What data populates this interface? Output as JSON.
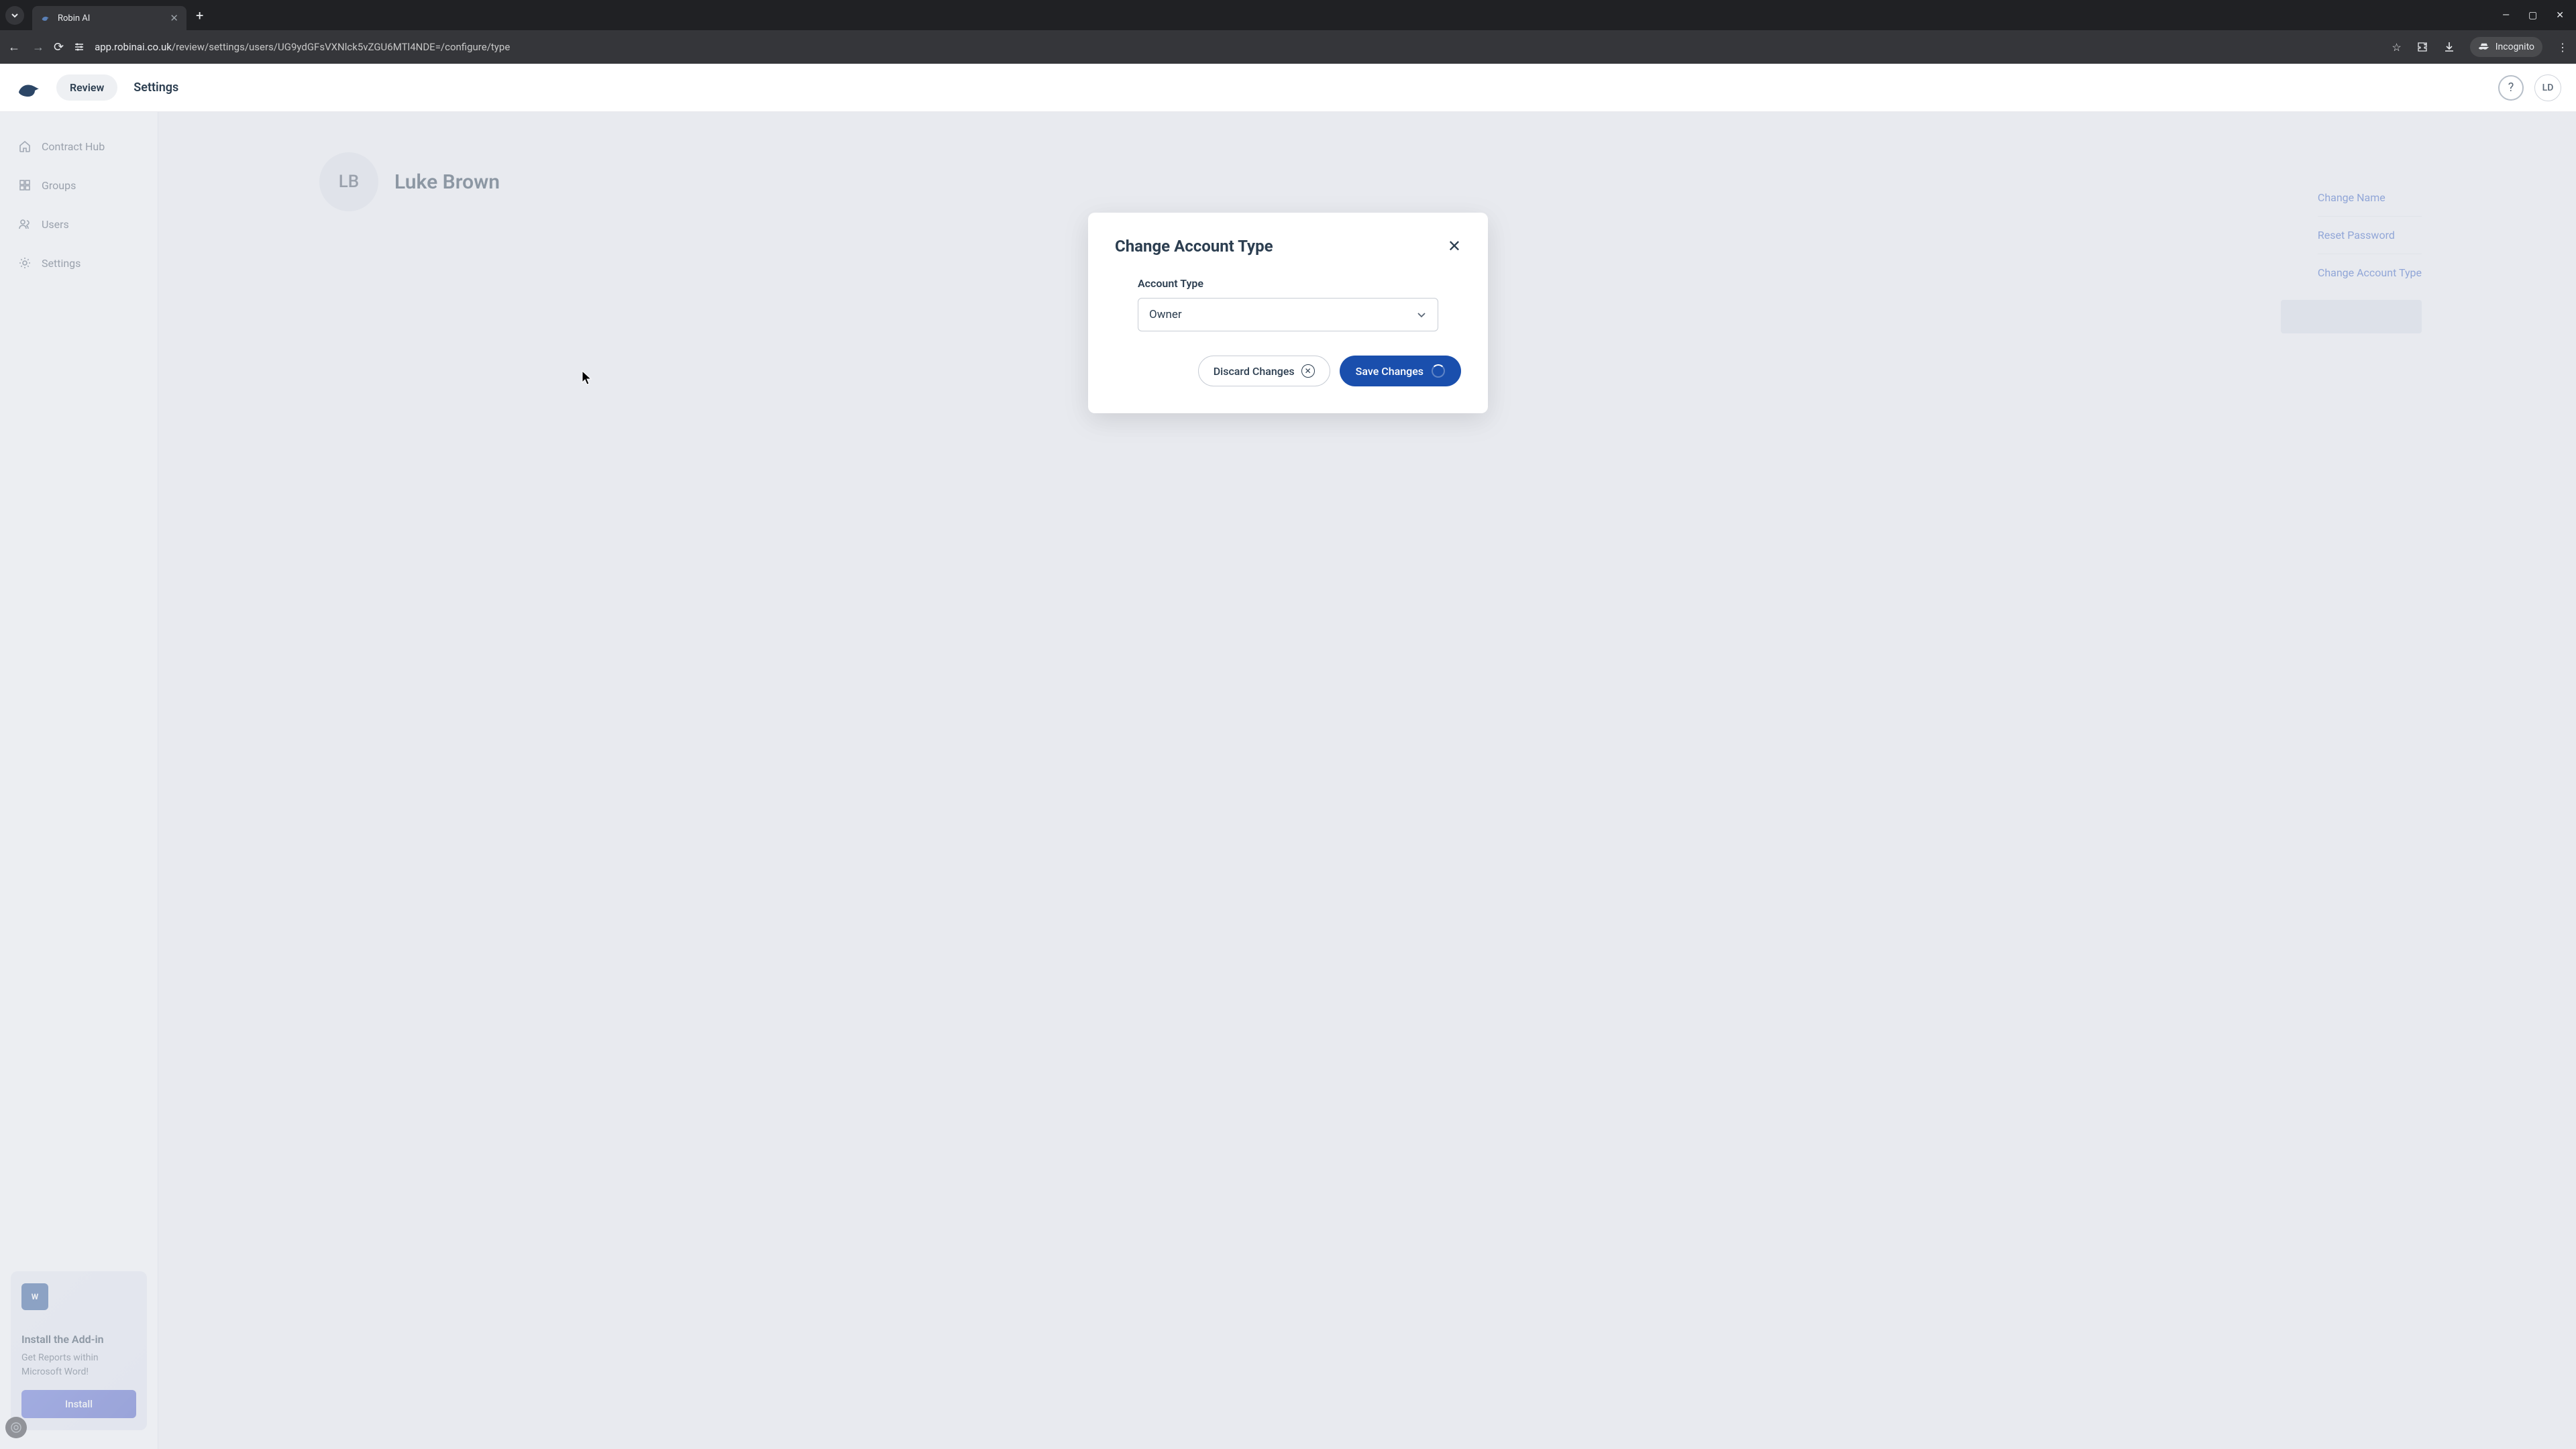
{
  "browser": {
    "tab_title": "Robin AI",
    "url_prefix": "app.robinai.co.uk",
    "url_path": "/review/settings/users/UG9ydGFsVXNlck5vZGU6MTl4NDE=/configure/type",
    "incognito_label": "Incognito"
  },
  "header": {
    "nav_review": "Review",
    "nav_settings": "Settings",
    "user_initials": "LD"
  },
  "sidebar": {
    "items": [
      {
        "label": "Contract Hub"
      },
      {
        "label": "Groups"
      },
      {
        "label": "Users"
      },
      {
        "label": "Settings"
      }
    ],
    "addin": {
      "title": "Install the Add-in",
      "description": "Get Reports within Microsoft Word!",
      "button": "Install"
    }
  },
  "main": {
    "user_initials": "LB",
    "user_name": "Luke Brown",
    "actions": {
      "change_name": "Change Name",
      "reset_password": "Reset Password",
      "change_account_type": "Change Account Type"
    }
  },
  "modal": {
    "title": "Change Account Type",
    "field_label": "Account Type",
    "selected_value": "Owner",
    "discard_label": "Discard Changes",
    "save_label": "Save Changes"
  }
}
